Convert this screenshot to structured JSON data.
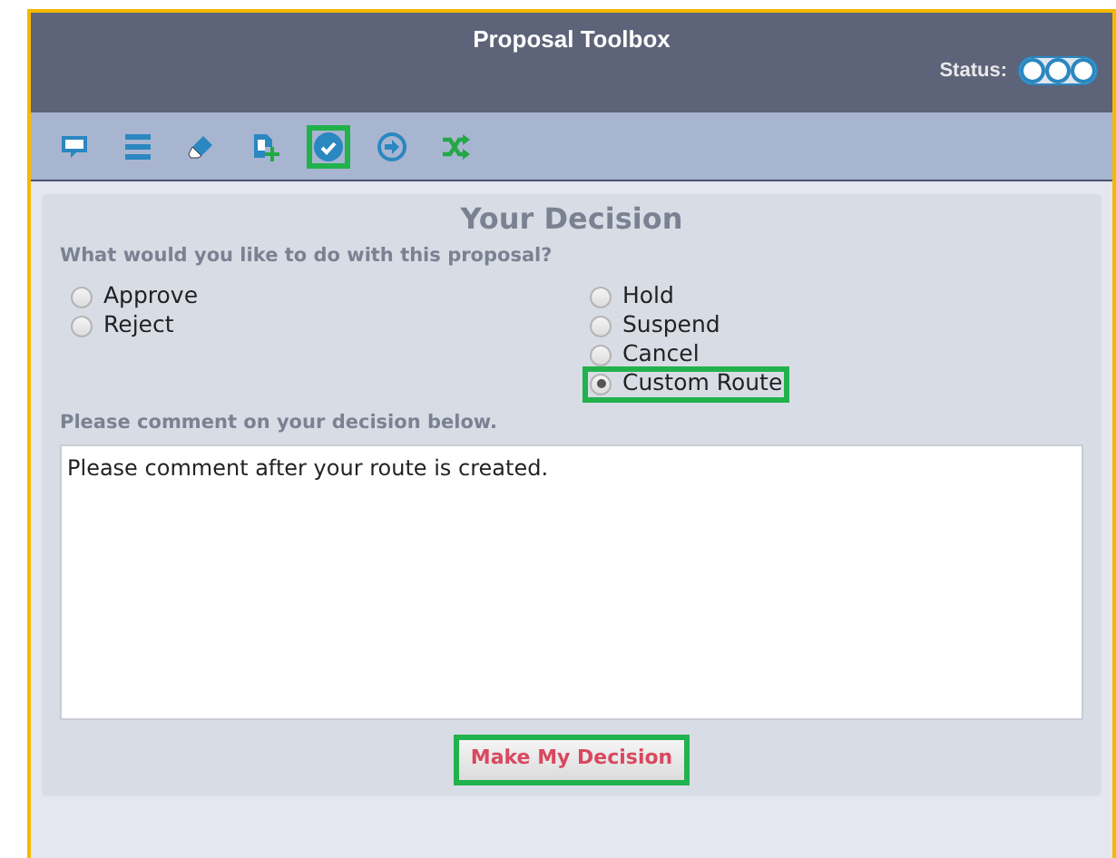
{
  "window": {
    "title": "Proposal Toolbox",
    "status_label": "Status:"
  },
  "toolbar": [
    {
      "kind": "comment",
      "highlighted": false
    },
    {
      "kind": "list",
      "highlighted": false
    },
    {
      "kind": "edit",
      "highlighted": false
    },
    {
      "kind": "add",
      "highlighted": false
    },
    {
      "kind": "check",
      "highlighted": true
    },
    {
      "kind": "forward",
      "highlighted": false
    },
    {
      "kind": "shuffle",
      "highlighted": false
    }
  ],
  "panel": {
    "title": "Your Decision",
    "question": "What would you like to do with this proposal?",
    "options_left": [
      {
        "label": "Approve",
        "selected": false,
        "highlighted": false
      },
      {
        "label": "Reject",
        "selected": false,
        "highlighted": false
      }
    ],
    "options_right": [
      {
        "label": "Hold",
        "selected": false,
        "highlighted": false
      },
      {
        "label": "Suspend",
        "selected": false,
        "highlighted": false
      },
      {
        "label": "Cancel",
        "selected": false,
        "highlighted": false
      },
      {
        "label": "Custom Route",
        "selected": true,
        "highlighted": true
      }
    ],
    "comment_label": "Please comment on your decision below.",
    "comment": {
      "value": "Please comment after your route is created."
    },
    "submit": {
      "label": "Make My Decision",
      "highlighted": true
    }
  }
}
